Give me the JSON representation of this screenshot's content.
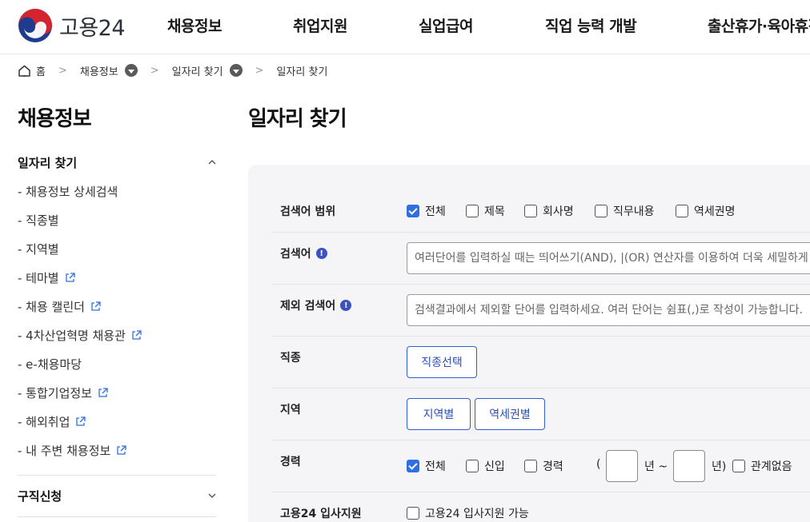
{
  "header": {
    "logo_text": "고용24",
    "nav": [
      "채용정보",
      "취업지원",
      "실업급여",
      "직업 능력 개발",
      "출산휴가·육아휴직"
    ]
  },
  "breadcrumb": {
    "home": "홈",
    "level1": "채용정보",
    "level2": "일자리 찾기",
    "current": "일자리 찾기"
  },
  "sidebar": {
    "title": "채용정보",
    "section1": {
      "label": "일자리 찾기",
      "items": [
        {
          "label": "- 채용정보 상세검색",
          "external": false
        },
        {
          "label": "- 직종별",
          "external": false
        },
        {
          "label": "- 지역별",
          "external": false
        },
        {
          "label": "- 테마별",
          "external": true
        },
        {
          "label": "- 채용 캘린더",
          "external": true
        },
        {
          "label": "- 4차산업혁명 채용관",
          "external": true
        },
        {
          "label": "- e-채용마당",
          "external": false
        },
        {
          "label": "- 통합기업정보",
          "external": true
        },
        {
          "label": "- 해외취업",
          "external": true
        },
        {
          "label": "- 내 주변 채용정보",
          "external": true
        }
      ]
    },
    "section2": {
      "label": "구직신청"
    }
  },
  "main": {
    "title": "일자리 찾기",
    "search_scope": {
      "label": "검색어 범위",
      "options": [
        {
          "label": "전체",
          "checked": true
        },
        {
          "label": "제목",
          "checked": false
        },
        {
          "label": "회사명",
          "checked": false
        },
        {
          "label": "직무내용",
          "checked": false
        },
        {
          "label": "역세권명",
          "checked": false
        }
      ]
    },
    "keyword": {
      "label": "검색어",
      "placeholder": "여러단어를 입력하실 때는 띄어쓰기(AND), |(OR) 연산자를 이용하여 더욱 세밀하게 검색하실 수 있습니다.",
      "value": ""
    },
    "exclude_keyword": {
      "label": "제외 검색어",
      "placeholder": "검색결과에서 제외할 단어를 입력하세요. 여러 단어는 쉼표(,)로 작성이 가능합니다.",
      "value": ""
    },
    "occupation": {
      "label": "직종",
      "button": "직종선택"
    },
    "region": {
      "label": "지역",
      "buttons": [
        "지역별",
        "역세권별"
      ]
    },
    "career": {
      "label": "경력",
      "options": [
        {
          "label": "전체",
          "checked": true
        },
        {
          "label": "신입",
          "checked": false
        },
        {
          "label": "경력",
          "checked": false
        }
      ],
      "open_paren": "(",
      "from_unit": "년 ~",
      "to_unit": "년)",
      "from_value": "",
      "to_value": "",
      "irrelevant": {
        "label": "관계없음",
        "checked": false
      }
    },
    "goyong24_apply": {
      "label": "고용24 입사지원",
      "option": {
        "label": "고용24 입사지원 가능",
        "checked": false
      }
    }
  },
  "colors": {
    "accent": "#2f6fe0",
    "button_border": "#2f5fd0",
    "info_icon": "#3b52c4",
    "panel_bg": "#f5f5f7"
  }
}
